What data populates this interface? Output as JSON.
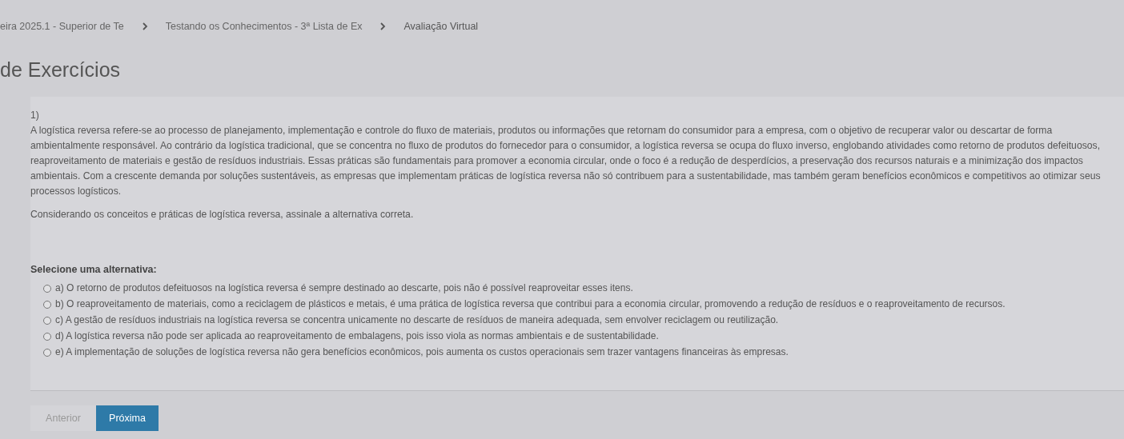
{
  "breadcrumb": [
    "eira 2025.1 - Superior de Te",
    "Testando os Conhecimentos - 3ª Lista de Ex",
    "Avaliação Virtual"
  ],
  "page_title": "de Exercícios",
  "question": {
    "number": "1)",
    "text": "A logística reversa refere-se ao processo de planejamento, implementação e controle do fluxo de materiais, produtos ou informações que retornam do consumidor para a empresa, com o objetivo de recuperar valor ou descartar de forma ambientalmente responsável. Ao contrário da logística tradicional, que se concentra no fluxo de produtos do fornecedor para o consumidor, a logística reversa se ocupa do fluxo inverso, englobando atividades como retorno de produtos defeituosos, reaproveitamento de materiais e gestão de resíduos industriais. Essas práticas são fundamentais para promover a economia circular, onde o foco é a redução de desperdícios, a preservação dos recursos naturais e a minimização dos impactos ambientais. Com a crescente demanda por soluções sustentáveis, as empresas que implementam práticas de logística reversa não só contribuem para a sustentabilidade, mas também geram benefícios econômicos e competitivos ao otimizar seus processos logísticos.",
    "prompt": "Considerando os conceitos e práticas de logística reversa, assinale a alternativa correta."
  },
  "select_label": "Selecione uma alternativa:",
  "options": [
    {
      "text": "a) O retorno de produtos defeituosos na logística reversa é sempre destinado ao descarte, pois não é possível reaproveitar esses itens.",
      "selected": false
    },
    {
      "text": "b) O reaproveitamento de materiais, como a reciclagem de plásticos e metais, é uma prática de logística reversa que contribui para a economia circular, promovendo a redução de resíduos e o reaproveitamento de recursos.",
      "selected": false
    },
    {
      "text": "c) A gestão de resíduos industriais na logística reversa se concentra unicamente no descarte de resíduos de maneira adequada, sem envolver reciclagem ou reutilização.",
      "selected": false
    },
    {
      "text": "d) A logística reversa não pode ser aplicada ao reaproveitamento de embalagens, pois isso viola as normas ambientais e de sustentabilidade.",
      "selected": false
    },
    {
      "text": "e) A implementação de soluções de logística reversa não gera benefícios econômicos, pois aumenta os custos operacionais sem trazer vantagens financeiras às empresas.",
      "selected": false
    }
  ],
  "buttons": [
    {
      "label": "Anterior",
      "disabled": true
    },
    {
      "label": "Próxima",
      "disabled": false
    }
  ]
}
